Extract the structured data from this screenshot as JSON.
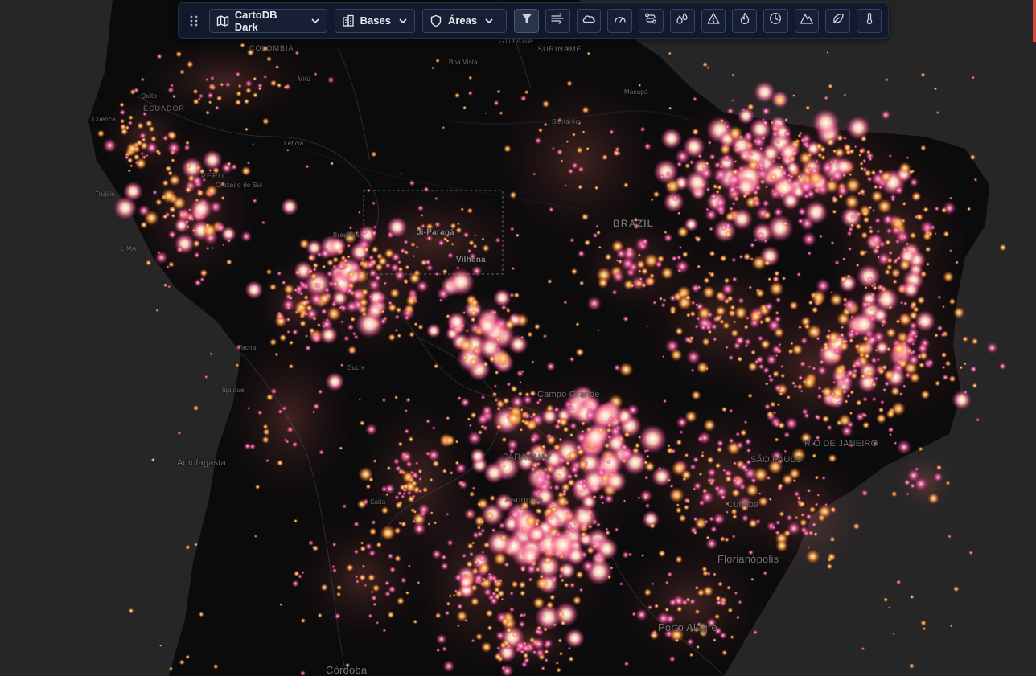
{
  "toolbar": {
    "basemap_label": "CartoDB Dark",
    "bases_label": "Bases",
    "areas_label": "Áreas",
    "icons": [
      {
        "name": "filter-icon",
        "active": true
      },
      {
        "name": "wind-lines-icon"
      },
      {
        "name": "cloud-icon"
      },
      {
        "name": "gauge-icon"
      },
      {
        "name": "route-icon"
      },
      {
        "name": "droplets-icon"
      },
      {
        "name": "warning-icon"
      },
      {
        "name": "flame-icon"
      },
      {
        "name": "clock-icon"
      },
      {
        "name": "mountain-icon"
      },
      {
        "name": "leaf-icon"
      },
      {
        "name": "thermometer-icon"
      }
    ]
  },
  "map": {
    "labels": {
      "colombia": "COLOMBIA",
      "guyana": "GUYANA",
      "suriname": "SURINAME",
      "boa_vista": "Boa Vista",
      "mitu": "Mitú",
      "macapa": "Macapá",
      "quito": "Quito",
      "ecuador": "ECUADOR",
      "cuenca": "Cuenca",
      "leticia": "Leticia",
      "santarem": "Santarém",
      "peru": "PERU",
      "cruzeiro": "Cruzeiro do Sul",
      "trujillo": "Trujillo",
      "brasileia": "Brasiléia",
      "ji_parana": "Ji-Paraná",
      "vilhena": "Vilhena",
      "brazil": "BRAZIL",
      "lima": "LIMA",
      "tacna": "Tacna",
      "sucre": "Sucre",
      "iquique": "Iquique",
      "campo_grande": "Campo Grande",
      "antofagasta": "Antofagasta",
      "asuncion": "Asunción",
      "paraguay": "PARAGUAY",
      "sao_paulo": "SÃO PAULO",
      "rio": "RIO DE JANEIRO",
      "curitiba": "Curitiba",
      "florianopolis": "Florianópolis",
      "porto_alegre": "Porto Alegre",
      "cordoba": "Córdoba",
      "salta": "Salta"
    }
  },
  "colors": {
    "background": "#262626",
    "land": "#0b0b0b",
    "accent_red": "#d9463a",
    "fire_core": "#ffffff",
    "fire_mid": "#ffb07a",
    "fire_outer": "#ff3d8a"
  }
}
